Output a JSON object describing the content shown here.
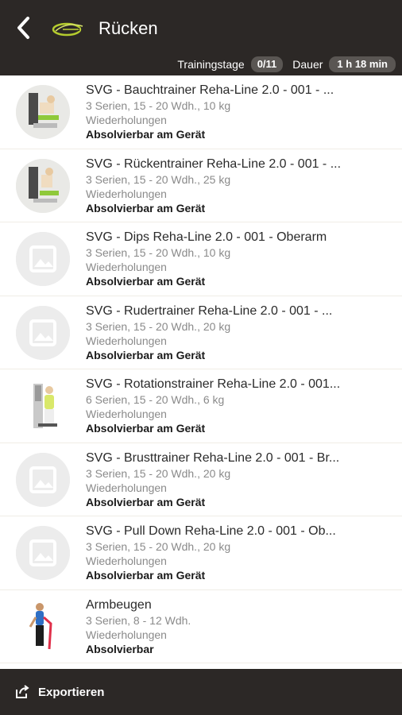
{
  "header": {
    "title": "Rücken",
    "back_icon": "chevron-left-icon",
    "training_days_label": "Trainingstage",
    "training_days_value": "0/11",
    "duration_label": "Dauer",
    "duration_value": "1 h 18 min"
  },
  "colors": {
    "header_bg": "#2c2826",
    "pill_bg": "#5a5653",
    "accent_logo": "#b5cc2e"
  },
  "exercises": [
    {
      "name": "SVG - Bauchtrainer Reha-Line 2.0 - 001 - ...",
      "sets": "3 Serien, 15 - 20 Wdh., 10 kg",
      "mode": "Wiederholungen",
      "availability": "Absolvierbar am Gerät",
      "thumb": "machine-photo"
    },
    {
      "name": "SVG - Rückentrainer Reha-Line 2.0 - 001 - ...",
      "sets": "3 Serien, 15 - 20 Wdh., 25 kg",
      "mode": "Wiederholungen",
      "availability": "Absolvierbar am Gerät",
      "thumb": "machine-photo"
    },
    {
      "name": "SVG - Dips Reha-Line 2.0 - 001 - Oberarm",
      "sets": "3 Serien, 15 - 20 Wdh., 10 kg",
      "mode": "Wiederholungen",
      "availability": "Absolvierbar am Gerät",
      "thumb": "image-placeholder"
    },
    {
      "name": "SVG - Rudertrainer Reha-Line 2.0 - 001 - ...",
      "sets": "3 Serien, 15 - 20 Wdh., 20 kg",
      "mode": "Wiederholungen",
      "availability": "Absolvierbar am Gerät",
      "thumb": "image-placeholder"
    },
    {
      "name": "SVG - Rotationstrainer Reha-Line 2.0 - 001...",
      "sets": "6 Serien, 15 - 20 Wdh., 6 kg",
      "mode": "Wiederholungen",
      "availability": "Absolvierbar am Gerät",
      "thumb": "rotation-photo"
    },
    {
      "name": "SVG - Brusttrainer Reha-Line 2.0 - 001 - Br...",
      "sets": "3 Serien, 15 - 20 Wdh., 20 kg",
      "mode": "Wiederholungen",
      "availability": "Absolvierbar am Gerät",
      "thumb": "image-placeholder"
    },
    {
      "name": "SVG - Pull Down Reha-Line 2.0 - 001 - Ob...",
      "sets": "3 Serien, 15 - 20 Wdh., 20 kg",
      "mode": "Wiederholungen",
      "availability": "Absolvierbar am Gerät",
      "thumb": "image-placeholder"
    },
    {
      "name": "Armbeugen",
      "sets": "3 Serien, 8 - 12 Wdh.",
      "mode": "Wiederholungen",
      "availability": "Absolvierbar",
      "thumb": "person-photo"
    }
  ],
  "footer": {
    "export_label": "Exportieren",
    "export_icon": "export-icon"
  }
}
